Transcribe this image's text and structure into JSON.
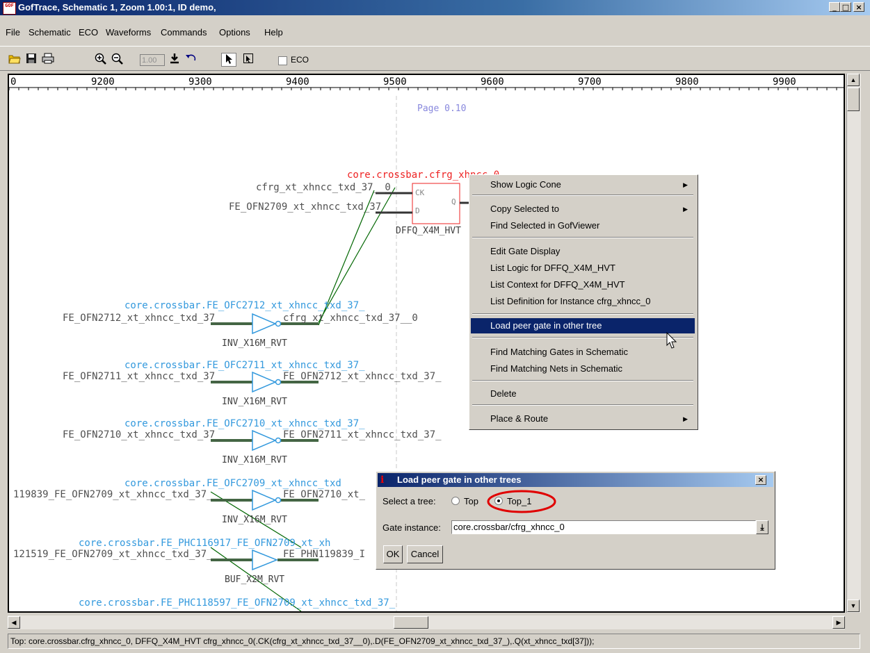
{
  "window": {
    "title": "GofTrace, Schematic 1, Zoom 1.00:1, ID demo,",
    "app_icon_text": "GOF",
    "minimize": "_",
    "maximize": "□",
    "close": "×"
  },
  "menu": [
    "File",
    "Schematic",
    "ECO",
    "Waveforms",
    "Commands",
    "Options",
    "Help"
  ],
  "toolbar": {
    "zoom_value": "1.00",
    "eco_label": "ECO",
    "icons": [
      "open-icon",
      "save-icon",
      "print-icon",
      "zoom-in-icon",
      "zoom-out-icon",
      "zoom-apply-icon",
      "undo-icon",
      "select-pointer-icon",
      "select-window-icon"
    ]
  },
  "ruler": {
    "origin_label": "0",
    "labels": [
      "9200",
      "9300",
      "9400",
      "9500",
      "9600",
      "9700",
      "9800",
      "9900"
    ]
  },
  "schematic": {
    "page_label": "Page 0.10",
    "dff_instance": "core.crossbar.cfrg_xhncc_0",
    "dff_cell": "DFFQ_X4M_HVT",
    "dff_pins": {
      "ck": "CK",
      "d": "D",
      "q": "Q"
    },
    "dff_ck_net": "cfrg_xt_xhncc_txd_37__0",
    "dff_d_net": "FE_OFN2709_xt_xhncc_txd_37_",
    "gates": [
      {
        "instance": "core.crossbar.FE_OFC2712_xt_xhncc_txd_37_",
        "in_net": "FE_OFN2712_xt_xhncc_txd_37_",
        "out_net": "cfrg_xt_xhncc_txd_37__0",
        "cell": "INV_X16M_RVT"
      },
      {
        "instance": "core.crossbar.FE_OFC2711_xt_xhncc_txd_37_",
        "in_net": "FE_OFN2711_xt_xhncc_txd_37_",
        "out_net": "FE_OFN2712_xt_xhncc_txd_37_",
        "cell": "INV_X16M_RVT"
      },
      {
        "instance": "core.crossbar.FE_OFC2710_xt_xhncc_txd_37_",
        "in_net": "FE_OFN2710_xt_xhncc_txd_37_",
        "out_net": "FE_OFN2711_xt_xhncc_txd_37_",
        "cell": "INV_X16M_RVT"
      },
      {
        "instance": "core.crossbar.FE_OFC2709_xt_xhncc_txd",
        "in_net": "119839_FE_OFN2709_xt_xhncc_txd_37_",
        "out_net": "FE_OFN2710_xt_",
        "cell": "INV_X16M_RVT"
      },
      {
        "instance": "core.crossbar.FE_PHC116917_FE_OFN2709_xt_xh",
        "in_net": "121519_FE_OFN2709_xt_xhncc_txd_37_",
        "out_net": "FE_PHN119839_I",
        "cell": "BUF_X2M_RVT"
      }
    ],
    "bottom_instance": "core.crossbar.FE_PHC118597_FE_OFN2709_xt_xhncc_txd_37_",
    "colors": {
      "instance": "#3399dd",
      "dff": "#ee2222",
      "net": "#505050",
      "page": "#8888dd",
      "wire": "#006600"
    }
  },
  "context_menu": {
    "items": [
      {
        "label": "Show Logic Cone",
        "submenu": true
      },
      {
        "label": "Copy Selected to",
        "submenu": true
      },
      {
        "label": "Find Selected in GofViewer",
        "submenu": false
      },
      {
        "label": "Edit Gate Display",
        "submenu": false
      },
      {
        "label": "List Logic for DFFQ_X4M_HVT",
        "submenu": false
      },
      {
        "label": "List Context for DFFQ_X4M_HVT",
        "submenu": false
      },
      {
        "label": "List Definition for Instance cfrg_xhncc_0",
        "submenu": false
      },
      {
        "label": "Load peer gate in other tree",
        "submenu": false,
        "highlighted": true
      },
      {
        "label": "Find Matching Gates in Schematic",
        "submenu": false
      },
      {
        "label": "Find Matching Nets in Schematic",
        "submenu": false
      },
      {
        "label": "Delete",
        "submenu": false
      },
      {
        "label": "Place & Route",
        "submenu": true
      }
    ]
  },
  "dialog": {
    "title": "Load peer gate in other trees",
    "select_tree_label": "Select a tree:",
    "tree_options": [
      {
        "label": "Top",
        "selected": false
      },
      {
        "label": "Top_1",
        "selected": true
      }
    ],
    "gate_instance_label": "Gate instance:",
    "gate_instance_value": "core.crossbar/cfrg_xhncc_0",
    "ok": "OK",
    "cancel": "Cancel",
    "highlight_color": "#e00000"
  },
  "status_bar": "Top: core.crossbar.cfrg_xhncc_0, DFFQ_X4M_HVT cfrg_xhncc_0(.CK(cfrg_xt_xhncc_txd_37__0),.D(FE_OFN2709_xt_xhncc_txd_37_),.Q(xt_xhncc_txd[37]));"
}
